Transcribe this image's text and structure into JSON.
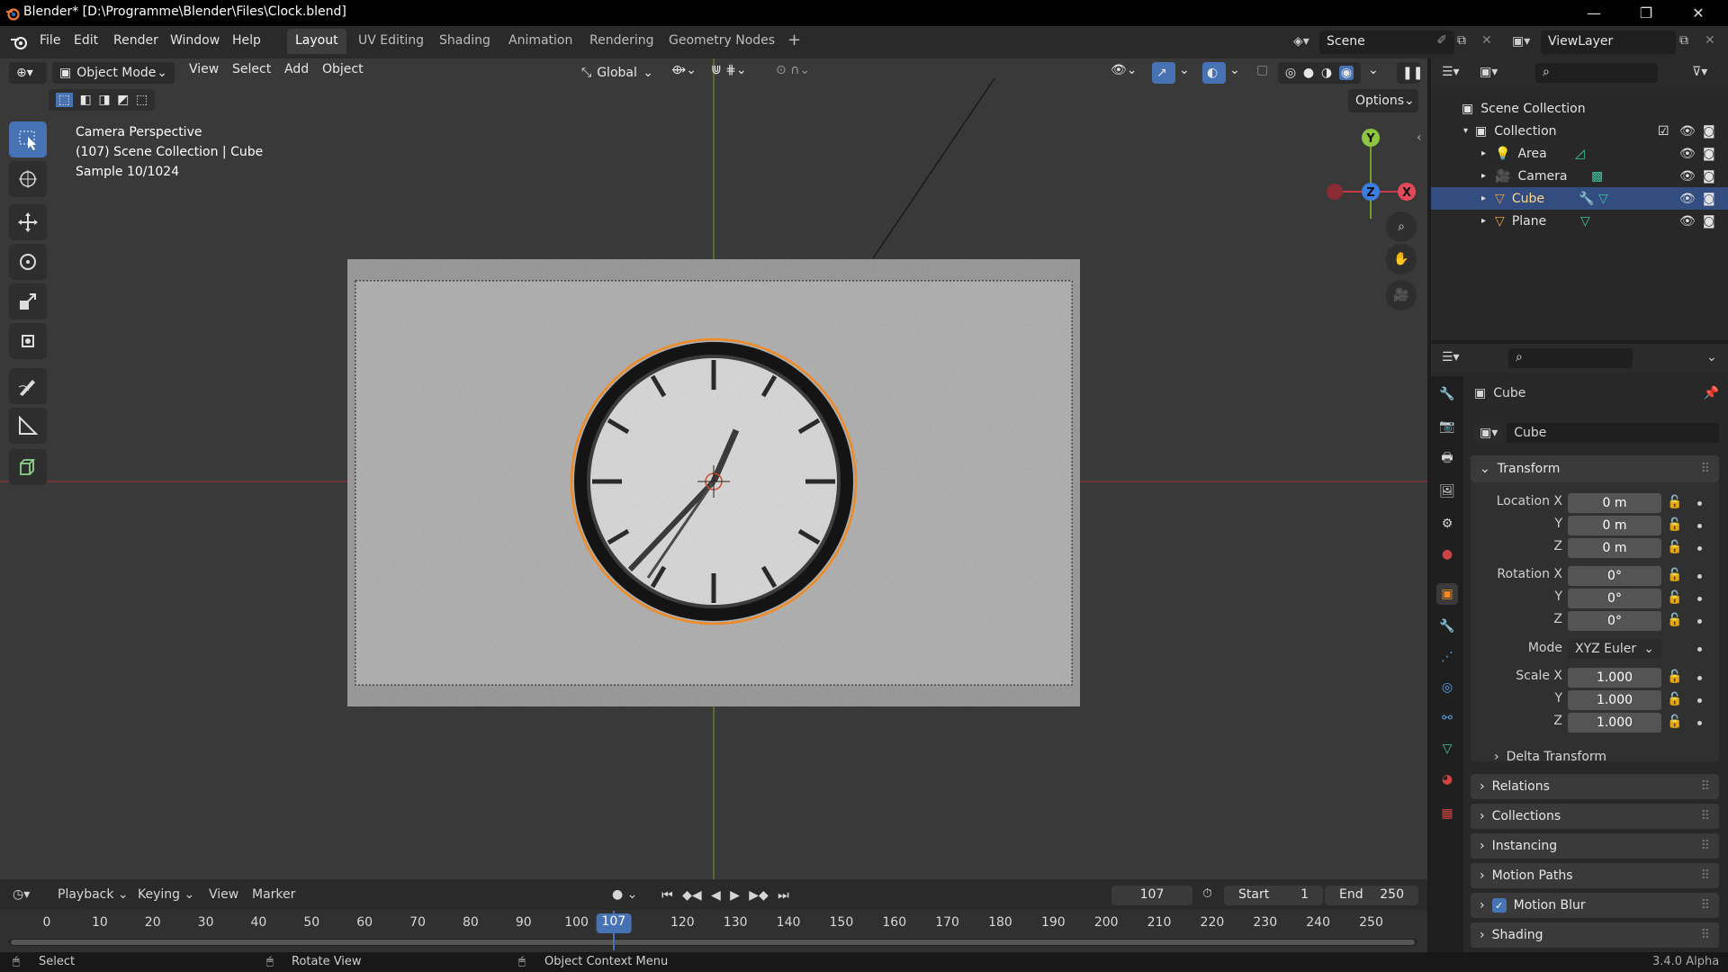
{
  "window": {
    "title": "Blender* [D:\\Programme\\Blender\\Files\\Clock.blend]",
    "minimize": "—",
    "maximize": "❐",
    "close": "✕"
  },
  "menu": {
    "items": [
      "File",
      "Edit",
      "Render",
      "Window",
      "Help"
    ]
  },
  "workspaces": {
    "tabs": [
      "Layout",
      "UV Editing",
      "Shading",
      "Animation",
      "Rendering",
      "Geometry Nodes"
    ],
    "active": "Layout",
    "add": "+"
  },
  "scene": {
    "name": "Scene",
    "view_layer": "ViewLayer"
  },
  "viewport_header": {
    "mode": "Object Mode",
    "menus": [
      "View",
      "Select",
      "Add",
      "Object"
    ],
    "transform_orientation": "Global",
    "options": "Options"
  },
  "viewport_overlay": {
    "line1": "Camera Perspective",
    "line2": "(107) Scene Collection | Cube",
    "line3": "Sample 10/1024"
  },
  "gizmo": {
    "y": "Y",
    "z": "Z",
    "x": "X"
  },
  "outliner": {
    "root": "Scene Collection",
    "collection": "Collection",
    "objects": [
      {
        "name": "Area",
        "selected": false
      },
      {
        "name": "Camera",
        "selected": false
      },
      {
        "name": "Cube",
        "selected": true
      },
      {
        "name": "Plane",
        "selected": false
      }
    ]
  },
  "properties": {
    "object_name": "Cube",
    "data_name": "Cube",
    "transform": {
      "header": "Transform",
      "location_label": "Location X",
      "rotation_label": "Rotation X",
      "scale_label": "Scale X",
      "y": "Y",
      "z": "Z",
      "location": [
        "0 m",
        "0 m",
        "0 m"
      ],
      "rotation": [
        "0°",
        "0°",
        "0°"
      ],
      "mode_label": "Mode",
      "mode": "XYZ Euler",
      "scale": [
        "1.000",
        "1.000",
        "1.000"
      ],
      "delta": "Delta Transform"
    },
    "panels": [
      "Relations",
      "Collections",
      "Instancing",
      "Motion Paths",
      "Motion Blur",
      "Shading"
    ]
  },
  "timeline": {
    "menus": [
      "Playback",
      "Keying",
      "View",
      "Marker"
    ],
    "current_frame": "107",
    "start_label": "Start",
    "start": "1",
    "end_label": "End",
    "end": "250",
    "ticks": [
      "0",
      "10",
      "20",
      "30",
      "40",
      "50",
      "60",
      "70",
      "80",
      "90",
      "100",
      "120",
      "130",
      "140",
      "150",
      "160",
      "170",
      "180",
      "190",
      "200",
      "210",
      "220",
      "230",
      "240",
      "250"
    ],
    "tick_frames": [
      0,
      10,
      20,
      30,
      40,
      50,
      60,
      70,
      80,
      90,
      100,
      120,
      130,
      140,
      150,
      160,
      170,
      180,
      190,
      200,
      210,
      220,
      230,
      240,
      250
    ],
    "playhead": "107"
  },
  "status": {
    "select": "Select",
    "rotate": "Rotate View",
    "context": "Object Context Menu",
    "version": "3.4.0 Alpha"
  },
  "colors": {
    "accent": "#4772b3",
    "selection": "#334d80",
    "outline_orange": "#f08a24"
  }
}
